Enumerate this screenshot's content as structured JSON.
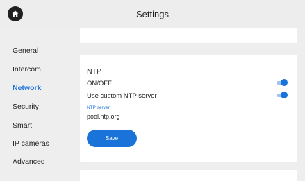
{
  "header": {
    "title": "Settings",
    "home_icon": "home-icon"
  },
  "sidebar": {
    "items": [
      {
        "label": "General",
        "active": false
      },
      {
        "label": "Intercom",
        "active": false
      },
      {
        "label": "Network",
        "active": true
      },
      {
        "label": "Security",
        "active": false
      },
      {
        "label": "Smart",
        "active": false
      },
      {
        "label": "IP cameras",
        "active": false
      },
      {
        "label": "Advanced",
        "active": false
      }
    ]
  },
  "ntp": {
    "section_title": "NTP",
    "on_off": {
      "label": "ON/OFF",
      "enabled": true
    },
    "custom_server": {
      "label": "Use custom NTP server",
      "enabled": true
    },
    "server_field": {
      "label": "NTP server",
      "value": "pool.ntp.org"
    },
    "save_label": "Save"
  },
  "colors": {
    "accent": "#1a73d9",
    "background": "#eeeeee",
    "card": "#ffffff",
    "toggle_track": "#9fc4f0"
  }
}
